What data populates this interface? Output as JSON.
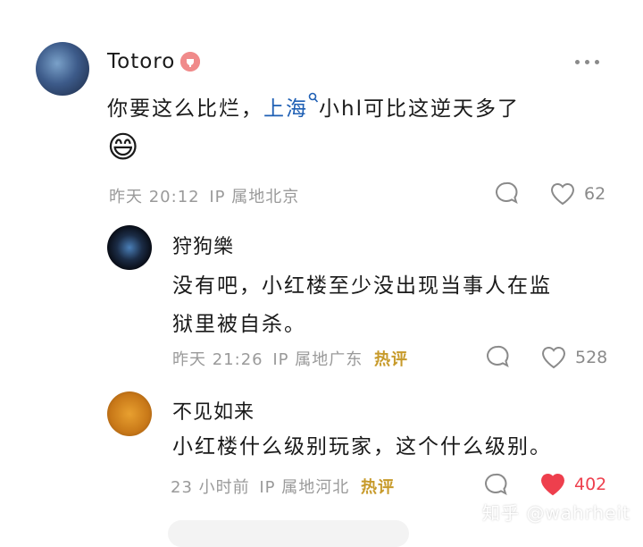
{
  "comments": [
    {
      "author": "Totoro",
      "text_before_link": "你要这么比烂，",
      "link_text": "上海",
      "text_after_link": "小hl可比这逆天多了",
      "emoji": "😄",
      "time": "昨天 20:12",
      "ip": "IP 属地北京",
      "likes": "62",
      "liked": false,
      "colors": {
        "avatar": "#3d5b8a"
      }
    },
    {
      "author": "狩狗樂",
      "text_line1": "没有吧，小红楼至少没出现当事人在监",
      "text_line2": "狱里被自杀。",
      "time": "昨天 21:26",
      "ip": "IP 属地广东",
      "hot": "热评",
      "likes": "528",
      "liked": false
    },
    {
      "author": "不见如来",
      "text": "小红楼什么级别玩家，这个什么级别。",
      "time": "23 小时前",
      "ip": "IP 属地河北",
      "hot": "热评",
      "likes": "402",
      "liked": true,
      "colors": {
        "liked": "#ee3f4d"
      }
    }
  ],
  "watermark": "知乎 @wahrheit",
  "icons": {
    "more": "more-dots-icon",
    "reply": "comment-bubble-icon",
    "like": "heart-icon",
    "search": "search-link-icon",
    "badge": "member-badge-icon"
  }
}
